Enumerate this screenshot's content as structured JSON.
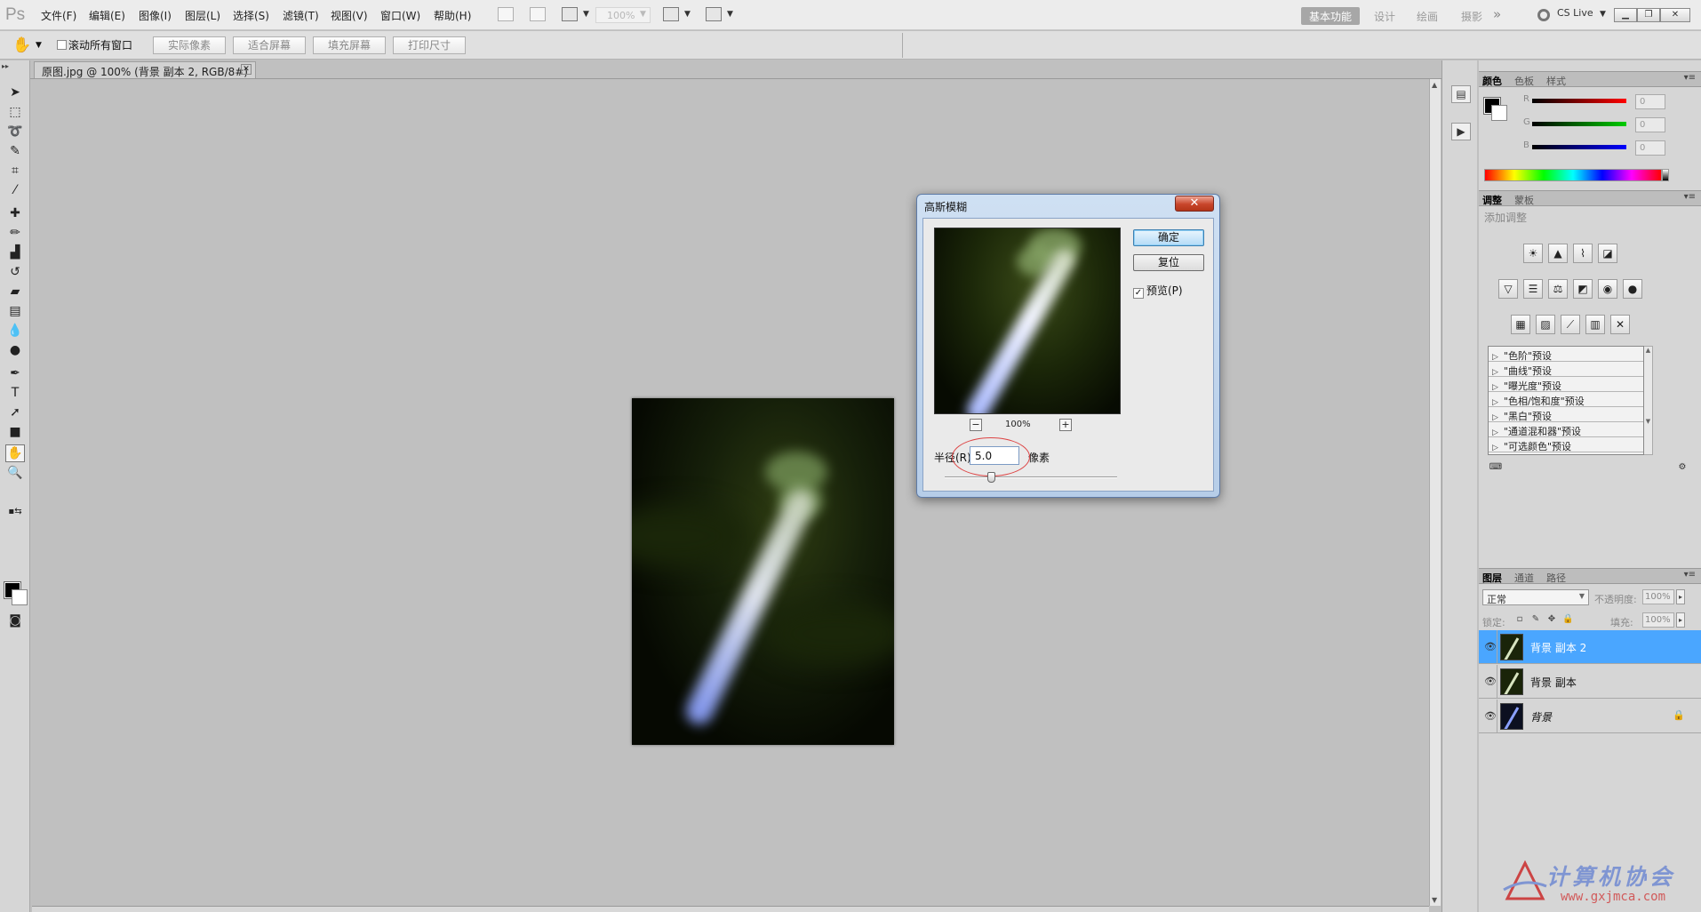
{
  "app": {
    "logo": "Ps",
    "menu": [
      "文件(F)",
      "编辑(E)",
      "图像(I)",
      "图层(L)",
      "选择(S)",
      "滤镜(T)",
      "视图(V)",
      "窗口(W)",
      "帮助(H)"
    ],
    "zoom_level": "100%",
    "workspaces": [
      "基本功能",
      "设计",
      "绘画",
      "摄影"
    ],
    "workspace_more": "»",
    "cs_live": "CS Live"
  },
  "options": {
    "scroll_all_windows": "滚动所有窗口",
    "buttons": [
      "实际像素",
      "适合屏幕",
      "填充屏幕",
      "打印尺寸"
    ]
  },
  "document": {
    "tab_title": "原图.jpg @ 100% (背景 副本 2, RGB/8#) *",
    "close_glyph": "✕"
  },
  "color_panel": {
    "tabs": [
      "颜色",
      "色板",
      "样式"
    ],
    "channels": [
      {
        "label": "R",
        "value": "0",
        "color": "#e02020"
      },
      {
        "label": "G",
        "value": "0",
        "color": "#20b020"
      },
      {
        "label": "B",
        "value": "0",
        "color": "#2020e0"
      }
    ]
  },
  "adjustments_panel": {
    "tabs": [
      "调整",
      "蒙板"
    ],
    "title": "添加调整",
    "icons_row1": [
      "☀",
      "▲",
      "⌇",
      "◪"
    ],
    "icons_row2": [
      "▽",
      "☰",
      "⚖",
      "◩",
      "◉",
      "●"
    ],
    "icons_row3": [
      "▦",
      "▨",
      "⟋",
      "▥",
      "✕"
    ],
    "presets": [
      "\"色阶\"预设",
      "\"曲线\"预设",
      "\"曝光度\"预设",
      "\"色相/饱和度\"预设",
      "\"黑白\"预设",
      "\"通道混和器\"预设",
      "\"可选颜色\"预设"
    ]
  },
  "layers_panel": {
    "tabs": [
      "图层",
      "通道",
      "路径"
    ],
    "blend_mode": "正常",
    "opacity_label": "不透明度:",
    "opacity": "100%",
    "lock_label": "锁定:",
    "fill_label": "填充:",
    "fill": "100%",
    "layers": [
      {
        "name": "背景 副本 2",
        "selected": true,
        "locked": false,
        "italic": false
      },
      {
        "name": "背景 副本",
        "selected": false,
        "locked": false,
        "italic": false
      },
      {
        "name": "背景",
        "selected": false,
        "locked": true,
        "italic": true
      }
    ]
  },
  "dialog": {
    "title": "高斯模糊",
    "close_glyph": "✕",
    "ok": "确定",
    "reset": "复位",
    "preview": "预览(P)",
    "preview_checked": true,
    "zoom_minus": "−",
    "zoom_plus": "+",
    "zoom": "100%",
    "radius_label": "半径(R):",
    "radius_value": "5.0",
    "radius_unit": "像素",
    "radius_slider_fraction": 0.27
  },
  "watermark": {
    "title": "计算机协会",
    "url": "www.gxjmca.com"
  }
}
